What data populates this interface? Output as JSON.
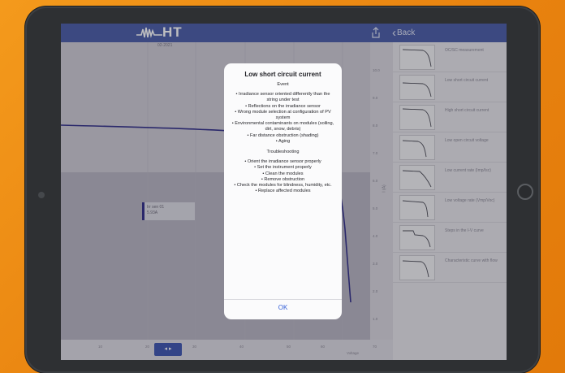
{
  "app": {
    "logo_text": "HT"
  },
  "nav": {
    "back_label": "Back"
  },
  "chart": {
    "date_label": "02-2021",
    "y_ticks": [
      "10.0",
      "9.0",
      "8.0",
      "7.0",
      "6.0",
      "5.0",
      "4.0",
      "3.0",
      "2.0",
      "1.0",
      "0.0"
    ],
    "x_ticks": [
      "10",
      "20",
      "30",
      "40",
      "50",
      "60",
      "70"
    ],
    "x_unit": "Voltage",
    "y_unit": "I (A)",
    "marker": {
      "line1": "Irr sen 01",
      "line2": "5.93A"
    },
    "scrubber_label": "◂ ▸"
  },
  "sidebar": {
    "items": [
      {
        "label": "OC/SC measurement"
      },
      {
        "label": "Low short circuit current"
      },
      {
        "label": "High short circuit current"
      },
      {
        "label": "Low open circuit voltage"
      },
      {
        "label": "Low current rate (Imp/Isc)"
      },
      {
        "label": "Low voltage rate (Vmp/Voc)"
      },
      {
        "label": "Steps in the I-V curve"
      },
      {
        "label": "Characteristic curve with flow"
      }
    ]
  },
  "alert": {
    "title": "Low short circuit current",
    "event_heading": "Event",
    "events": [
      "• Irradiance sensor oriented differently than the string under test",
      "• Reflections on the irradiance sensor",
      "• Wrong module selection at configuration of PV system",
      "• Environmental contaminants on modules (soiling, dirt, snow, debris)",
      "• Far distance obstruction (shading)",
      "• Aging"
    ],
    "troubleshooting_heading": "Troubleshooting",
    "steps": [
      "• Orient the irradiance sensor properly",
      "• Set the instrument properly",
      "• Clean the modules",
      "• Remove obstruction",
      "• Check the modules for blindness, humidity, etc.",
      "• Replace affected modules"
    ],
    "ok_label": "OK"
  },
  "colors": {
    "background": "#f28f16",
    "nav_bar": "#4c5ea8",
    "curve": "#33308a",
    "ok_text": "#3560d8"
  }
}
